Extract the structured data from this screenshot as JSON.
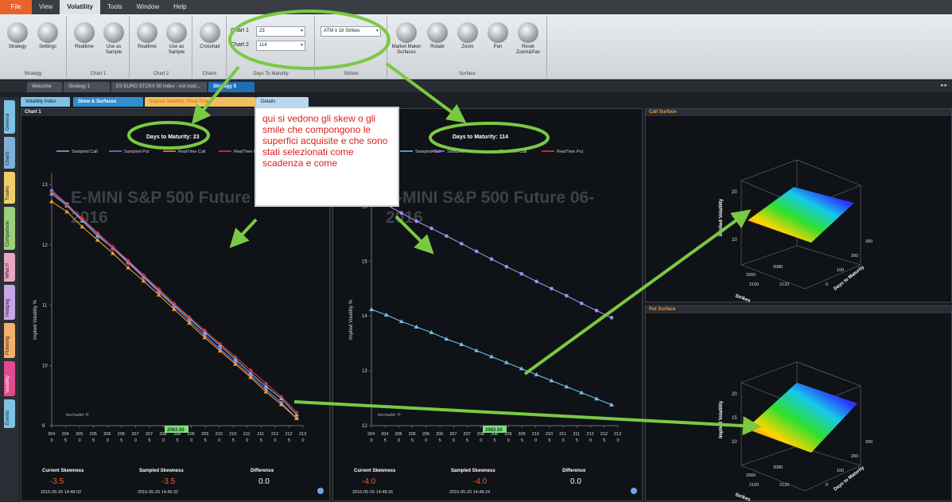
{
  "menu": [
    "File",
    "View",
    "Volatility",
    "Tools",
    "Window",
    "Help"
  ],
  "ribbon": {
    "strategy_buttons": [
      "Strategy",
      "Settings"
    ],
    "strategy_group": "Strategy",
    "chart1_buttons": [
      "Realtime",
      "Use as Sample"
    ],
    "chart1_group": "Chart 1",
    "chart2_buttons": [
      "Realtime",
      "Use as Sample"
    ],
    "chart2_group": "Chart 2",
    "charts_button": "Crosshair",
    "charts_group": "Charts",
    "chart1_label": "Chart 1",
    "chart1_value": "23",
    "chart2_label": "Chart 2",
    "chart2_value": "114",
    "days_group": "Days To Maturity",
    "strikes_value": "ATM ± 16 Strikes",
    "strikes_group": "Strikes",
    "surface_buttons": [
      "Market Maker Surfaces",
      "Rotate",
      "Zoom",
      "Pan",
      "Reset Zoom&Pan"
    ],
    "surface_group": "Surface"
  },
  "doc_tabs": [
    "Welcome",
    "Strategy 1",
    "ES EURO STOXX 50 Index - not mod...",
    "Strategy 5"
  ],
  "sub_tabs": [
    "Volatility Index",
    "Skew & Surfaces",
    "Implied Volatility / Real Time",
    "Details"
  ],
  "side_tabs": [
    "General",
    "Charts",
    "Trades",
    "Comparison",
    "What If",
    "Hedging",
    "Planning",
    "Volatility",
    "Events"
  ],
  "annotation": "qui si vedono gli skew o gli smile che compongono le superfici acquisite e che sono stati selezionati come scadenza e come",
  "chart1": {
    "panel_title": "Chart 1",
    "days_label": "Days to Maturity: 23",
    "legend": [
      "Sampled Call",
      "Sampled Put",
      "RealTime Call",
      "RealTime Put"
    ],
    "watermark_line1": "E-MINI S&P 500 Future 06-",
    "watermark_line2": "2016",
    "ylabel": "Implied Volatility %",
    "yticks": [
      "13",
      "12",
      "11",
      "10",
      "9"
    ],
    "xticks_top": [
      "204",
      "204",
      "205",
      "205",
      "206",
      "206",
      "207",
      "207",
      "208",
      "208",
      "209",
      "209",
      "210",
      "210",
      "211",
      "211",
      "212",
      "212",
      "213"
    ],
    "xticks_bottom": [
      "0",
      "5",
      "0",
      "5",
      "0",
      "5",
      "0",
      "5",
      "0",
      "5",
      "0",
      "5",
      "0",
      "5",
      "0",
      "5",
      "0",
      "5",
      "0"
    ],
    "current_price": "2083.50",
    "brand": "bechader ®",
    "current_skew_label": "Current Skewness",
    "current_skew": "-3.5",
    "current_time": "2016-05-25 14:48:02",
    "sampled_skew_label": "Sampled Skewness",
    "sampled_skew": "-3.5",
    "sampled_time": "2016-05-25 14:45:32",
    "diff_label": "Difference",
    "diff": "0.0"
  },
  "chart2": {
    "days_label": "Days to Maturity: 114",
    "legend": [
      "Sampled Call",
      "Sampled Put",
      "RealTime Call",
      "RealTime Put"
    ],
    "watermark_line1": "E-MINI S&P 500 Future 06-",
    "watermark_line2": "2016",
    "ylabel": "Implied Volatility %",
    "yticks": [
      "16",
      "15",
      "14",
      "13",
      "12"
    ],
    "current_price": "2083.50",
    "brand": "bechader ®",
    "current_skew_label": "Current Skewness",
    "current_skew": "-4.0",
    "current_time": "2016-05-25 14:48:26",
    "sampled_skew_label": "Sampled Skewness",
    "sampled_skew": "-4.0",
    "sampled_time": "2016-05-25 14:48:24",
    "diff_label": "Difference",
    "diff": "0.0"
  },
  "surface_call": {
    "title": "Call Surface",
    "z_label": "Implied Volatility",
    "strikes_label": "Strikes",
    "days_label": "Days to Maturity",
    "ticks_z": [
      "20",
      "15",
      "10"
    ],
    "ticks_strike": [
      "2060",
      "2080",
      "2100",
      "2120"
    ],
    "ticks_days": [
      "300",
      "200",
      "100",
      "0"
    ]
  },
  "surface_put": {
    "title": "Put Surface",
    "z_label": "Implied Volatility",
    "strikes_label": "Strikes",
    "days_label": "Days to Maturity",
    "ticks_z": [
      "20",
      "15",
      "10"
    ],
    "ticks_strike": [
      "2060",
      "2080",
      "2100",
      "2120"
    ],
    "ticks_days": [
      "300",
      "200",
      "100",
      "0"
    ]
  },
  "chart_data": [
    {
      "type": "line",
      "title": "Days to Maturity: 23",
      "ylabel": "Implied Volatility %",
      "ylim": [
        9,
        13.2
      ],
      "x": [
        2040,
        2045,
        2050,
        2055,
        2060,
        2065,
        2070,
        2075,
        2080,
        2085,
        2090,
        2095,
        2100,
        2105,
        2110,
        2115,
        2120
      ],
      "series": [
        {
          "name": "Sampled Call",
          "color": "#6fc0ef",
          "values": [
            12.85,
            12.65,
            12.4,
            12.15,
            11.95,
            11.72,
            11.48,
            11.24,
            11.0,
            10.78,
            10.55,
            10.33,
            10.1,
            9.87,
            9.65,
            9.45,
            9.18
          ]
        },
        {
          "name": "Sampled Put",
          "color": "#8a79e8",
          "values": [
            12.9,
            12.68,
            12.42,
            12.18,
            11.94,
            11.7,
            11.46,
            11.22,
            10.98,
            10.74,
            10.5,
            10.27,
            10.05,
            9.83,
            9.6,
            9.38,
            9.12
          ]
        },
        {
          "name": "RealTime Call",
          "color": "#f39a2c",
          "values": [
            12.72,
            12.55,
            12.3,
            12.08,
            11.86,
            11.62,
            11.4,
            11.17,
            10.93,
            10.7,
            10.46,
            10.24,
            10.02,
            9.8,
            9.56,
            9.35,
            9.12
          ]
        },
        {
          "name": "RealTime Put",
          "color": "#e63a3a",
          "values": [
            12.88,
            12.66,
            12.44,
            12.2,
            11.97,
            11.74,
            11.5,
            11.27,
            11.03,
            10.8,
            10.58,
            10.36,
            10.14,
            9.92,
            9.7,
            9.48,
            9.22
          ]
        }
      ]
    },
    {
      "type": "line",
      "title": "Days to Maturity: 114",
      "ylabel": "Implied Volatility %",
      "ylim": [
        12,
        16.5
      ],
      "x": [
        2040,
        2045,
        2050,
        2055,
        2060,
        2065,
        2070,
        2075,
        2080,
        2085,
        2090,
        2095,
        2100,
        2105,
        2110,
        2115,
        2120
      ],
      "series": [
        {
          "name": "Sampled Call",
          "color": "#6fc0ef",
          "values": [
            14.12,
            14.02,
            13.9,
            13.8,
            13.7,
            13.58,
            13.48,
            13.37,
            13.26,
            13.15,
            13.04,
            12.93,
            12.82,
            12.71,
            12.6,
            12.49,
            12.38
          ]
        },
        {
          "name": "Sampled Put",
          "color": "#a58cf0",
          "values": [
            16.18,
            16.03,
            15.88,
            15.73,
            15.6,
            15.46,
            15.32,
            15.18,
            15.04,
            14.9,
            14.77,
            14.63,
            14.5,
            14.37,
            14.23,
            14.1,
            13.97
          ]
        }
      ]
    }
  ]
}
